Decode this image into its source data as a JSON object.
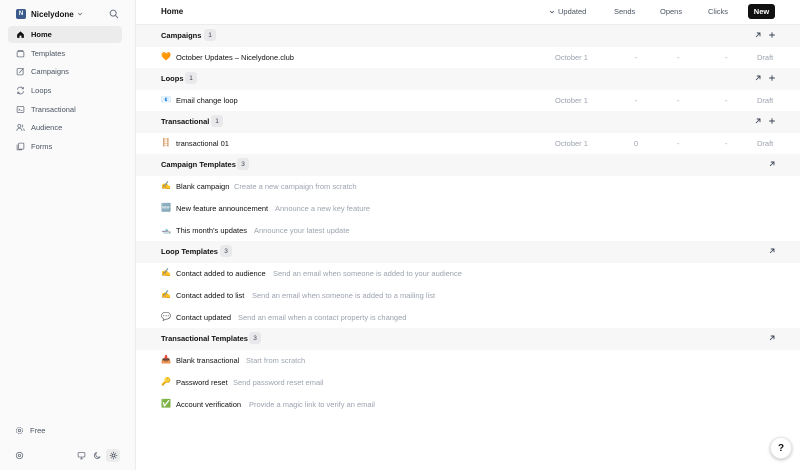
{
  "workspace": {
    "initial": "N",
    "name": "Nicelydone"
  },
  "sidebar": {
    "items": [
      {
        "label": "Home",
        "icon": "home-icon"
      },
      {
        "label": "Templates",
        "icon": "template-icon"
      },
      {
        "label": "Campaigns",
        "icon": "campaign-icon"
      },
      {
        "label": "Loops",
        "icon": "loop-icon"
      },
      {
        "label": "Transactional",
        "icon": "transactional-icon"
      },
      {
        "label": "Audience",
        "icon": "audience-icon"
      },
      {
        "label": "Forms",
        "icon": "forms-icon"
      }
    ],
    "plan": "Free"
  },
  "header": {
    "title": "Home",
    "sort": "Updated",
    "columns": [
      "Sends",
      "Opens",
      "Clicks"
    ],
    "new_label": "New"
  },
  "sections": {
    "campaigns": {
      "title": "Campaigns",
      "count": "1",
      "rows": [
        {
          "emoji": "🧡",
          "title": "October Updates – Nicelydone.club",
          "date": "October 1",
          "c1": "-",
          "c2": "-",
          "c3": "-",
          "status": "Draft"
        }
      ]
    },
    "loops": {
      "title": "Loops",
      "count": "1",
      "rows": [
        {
          "emoji": "📧",
          "title": "Email change loop",
          "date": "October 1",
          "c1": "-",
          "c2": "-",
          "c3": "-",
          "status": "Draft"
        }
      ]
    },
    "transactional": {
      "title": "Transactional",
      "count": "1",
      "rows": [
        {
          "emoji": "🪜",
          "title": "transactional 01",
          "date": "October 1",
          "c1": "0",
          "c2": "-",
          "c3": "-",
          "status": "Draft"
        }
      ]
    },
    "campaign_templates": {
      "title": "Campaign Templates",
      "count": "3",
      "rows": [
        {
          "emoji": "✍️",
          "title": "Blank campaign",
          "desc": "Create a new campaign from scratch"
        },
        {
          "emoji": "🆕",
          "title": "New feature announcement",
          "desc": "Announce a new key feature"
        },
        {
          "emoji": "🛥️",
          "title": "This month's updates",
          "desc": "Announce your latest update"
        }
      ]
    },
    "loop_templates": {
      "title": "Loop Templates",
      "count": "3",
      "rows": [
        {
          "emoji": "✍️",
          "title": "Contact added to audience",
          "desc": "Send an email when someone is added to your audience"
        },
        {
          "emoji": "✍️",
          "title": "Contact added to list",
          "desc": "Send an email when someone is added to a mailing list"
        },
        {
          "emoji": "💬",
          "title": "Contact updated",
          "desc": "Send an email when a contact property is changed"
        }
      ]
    },
    "transactional_templates": {
      "title": "Transactional Templates",
      "count": "3",
      "rows": [
        {
          "emoji": "📥",
          "title": "Blank transactional",
          "desc": "Start from scratch"
        },
        {
          "emoji": "🔑",
          "title": "Password reset",
          "desc": "Send password reset email"
        },
        {
          "emoji": "✅",
          "title": "Account verification",
          "desc": "Provide a magic link to verify an email"
        }
      ]
    }
  },
  "help": "?"
}
